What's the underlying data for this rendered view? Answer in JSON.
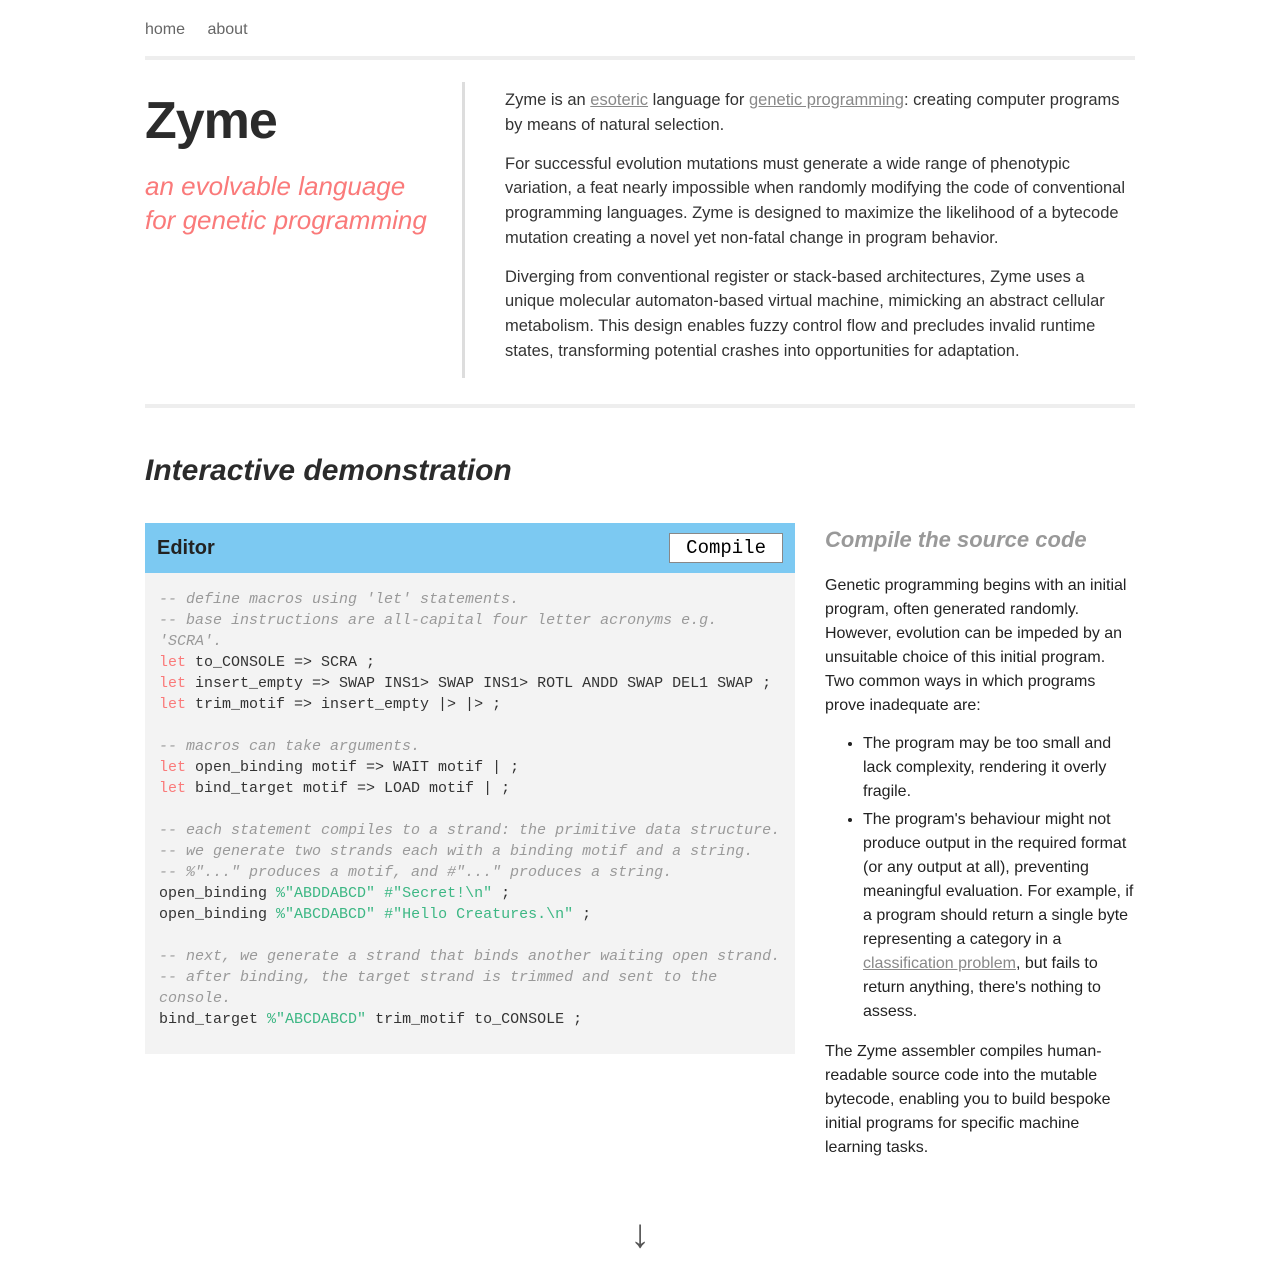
{
  "nav": {
    "home": "home",
    "about": "about"
  },
  "title": "Zyme",
  "subtitle": "an evolvable language for genetic programming",
  "intro": {
    "p1a": "Zyme is an ",
    "p1_link1": "esoteric",
    "p1b": " language for ",
    "p1_link2": "genetic programming",
    "p1c": ": creating computer programs by means of natural selection.",
    "p2": "For successful evolution mutations must generate a wide range of phenotypic variation, a feat nearly impossible when randomly modifying the code of conventional programming languages. Zyme is designed to maximize the likelihood of a bytecode mutation creating a novel yet non-fatal change in program behavior.",
    "p3": "Diverging from conventional register or stack-based architectures, Zyme uses a unique molecular automaton-based virtual machine, mimicking an abstract cellular metabolism. This design enables fuzzy control flow and precludes invalid runtime states, transforming potential crashes into opportunities for adaptation."
  },
  "demo_heading": "Interactive demonstration",
  "editor": {
    "label": "Editor",
    "compile": "Compile",
    "code": {
      "c1": "-- define macros using 'let' statements.",
      "c2": "-- base instructions are all-capital four letter acronyms e.g. 'SCRA'.",
      "l1a": "let",
      "l1b": " to_CONSOLE => SCRA ;",
      "l2a": "let",
      "l2b": " insert_empty => SWAP INS1> SWAP INS1> ROTL ANDD SWAP DEL1 SWAP ;",
      "l3a": "let",
      "l3b": " trim_motif => insert_empty |> |> ;",
      "c3": "-- macros can take arguments.",
      "l4a": "let",
      "l4b": " open_binding motif => WAIT motif | ;",
      "l5a": "let",
      "l5b": " bind_target motif => LOAD motif | ;",
      "c4": "-- each statement compiles to a strand: the primitive data structure.",
      "c5": "-- we generate two strands each with a binding motif and a string.",
      "c6": "-- %\"...\" produces a motif, and #\"...\" produces a string.",
      "l6a": "open_binding ",
      "l6b": "%\"ABDDABCD\"",
      "l6c": " ",
      "l6d": "#\"Secret!\\n\"",
      "l6e": " ;",
      "l7a": "open_binding ",
      "l7b": "%\"ABCDABCD\"",
      "l7c": " ",
      "l7d": "#\"Hello Creatures.\\n\"",
      "l7e": " ;",
      "c7": "-- next, we generate a strand that binds another waiting open strand.",
      "c8": "-- after binding, the target strand is trimmed and sent to the console.",
      "l8a": "bind_target ",
      "l8b": "%\"ABCDABCD\"",
      "l8c": " trim_motif to_CONSOLE ;"
    }
  },
  "side": {
    "title": "Compile the source code",
    "p1": "Genetic programming begins with an initial program, often generated randomly. However, evolution can be impeded by an unsuitable choice of this initial program. Two common ways in which programs prove inadequate are:",
    "li1": "The program may be too small and lack complexity, rendering it overly fragile.",
    "li2a": "The program's behaviour might not produce output in the required format (or any output at all), preventing meaningful evaluation. For example, if a program should return a single byte representing a category in a ",
    "li2_link": "classification problem",
    "li2b": ", but fails to return anything, there's nothing to assess.",
    "p2": "The Zyme assembler compiles human-readable source code into the mutable bytecode, enabling you to build bespoke initial programs for specific machine learning tasks."
  },
  "arrow": "↓"
}
